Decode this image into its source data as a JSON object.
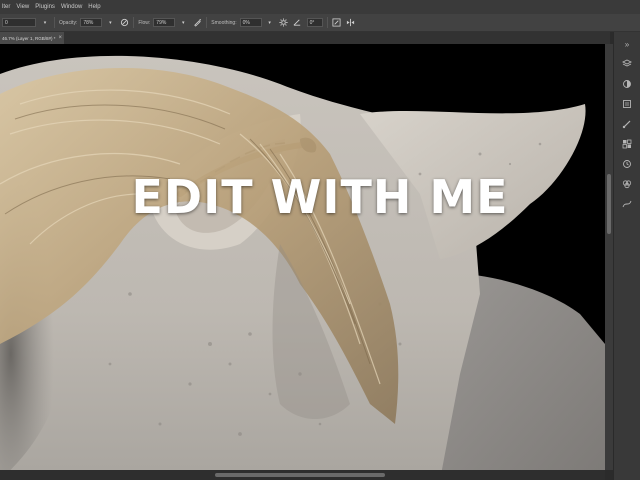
{
  "menu": {
    "items": [
      "lter",
      "View",
      "Plugins",
      "Window",
      "Help"
    ]
  },
  "options": {
    "left_field": "0",
    "opacity_label": "Opacity:",
    "opacity_value": "78%",
    "flow_label": "Flow:",
    "flow_value": "79%",
    "smoothing_label": "Smoothing:",
    "smoothing_value": "0%",
    "angle_value": "0°"
  },
  "document_tab": {
    "title": "46.7% (Layer 1, RGB/8#) *",
    "close_symbol": "×"
  },
  "overlay": {
    "title": "EDIT WITH ME"
  },
  "colors": {
    "ui_dark": "#2b2b2b",
    "panel": "#393939",
    "overlay_text": "#ffffff"
  },
  "icons": [
    "brush-icon",
    "airbrush-icon",
    "pressure-icon",
    "gear-icon",
    "angle-icon",
    "symmetry-icon"
  ]
}
